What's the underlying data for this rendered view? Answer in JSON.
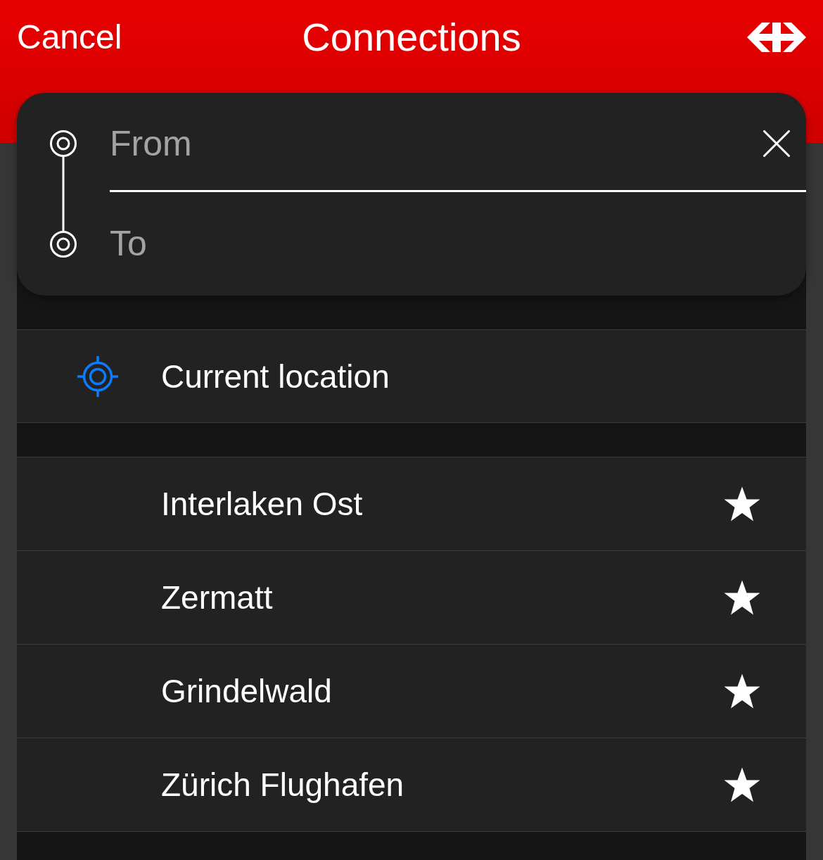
{
  "header": {
    "cancel": "Cancel",
    "title": "Connections"
  },
  "search": {
    "from": {
      "placeholder": "From"
    },
    "to": {
      "placeholder": "To"
    }
  },
  "location_row": {
    "label": "Current location"
  },
  "favorites": [
    {
      "name": "Interlaken Ost",
      "starred": true
    },
    {
      "name": "Zermatt",
      "starred": true
    },
    {
      "name": "Grindelwald",
      "starred": true
    },
    {
      "name": "Zürich Flughafen",
      "starred": true
    }
  ]
}
